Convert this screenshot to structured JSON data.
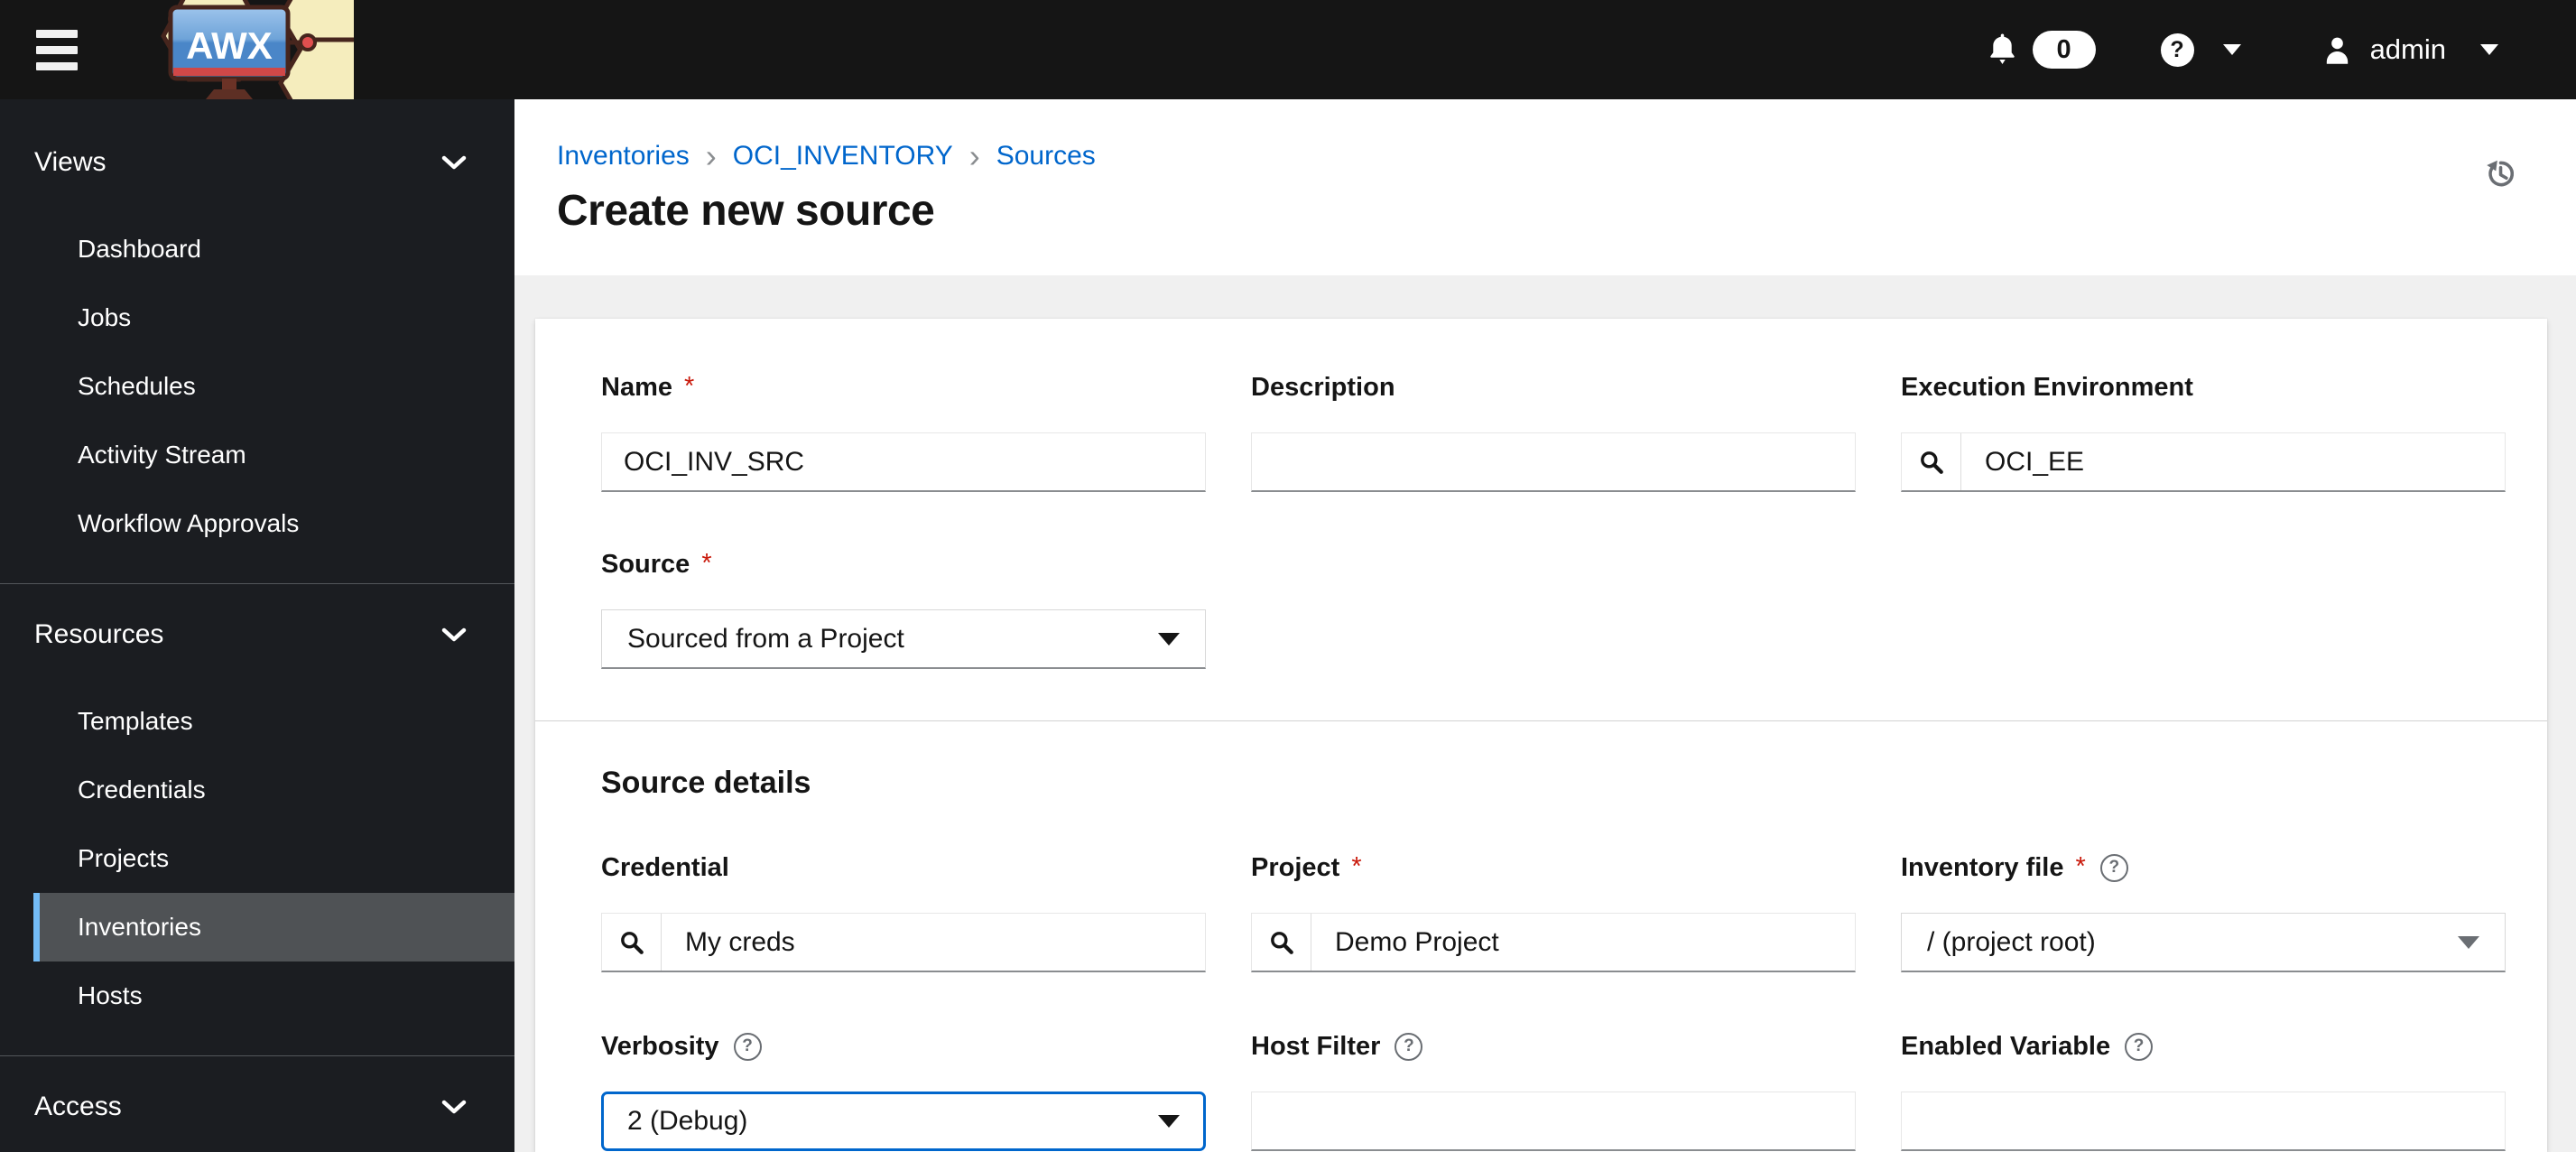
{
  "masthead": {
    "logo_text": "AWX",
    "notification_count": "0",
    "help_glyph": "?",
    "username": "admin"
  },
  "sidebar": {
    "groups": [
      {
        "label": "Views",
        "items": [
          {
            "label": "Dashboard"
          },
          {
            "label": "Jobs"
          },
          {
            "label": "Schedules"
          },
          {
            "label": "Activity Stream"
          },
          {
            "label": "Workflow Approvals"
          }
        ]
      },
      {
        "label": "Resources",
        "items": [
          {
            "label": "Templates"
          },
          {
            "label": "Credentials"
          },
          {
            "label": "Projects"
          },
          {
            "label": "Inventories"
          },
          {
            "label": "Hosts"
          }
        ]
      },
      {
        "label": "Access",
        "items": []
      }
    ]
  },
  "breadcrumb": {
    "separator": "›",
    "items": [
      {
        "label": "Inventories"
      },
      {
        "label": "OCI_INVENTORY"
      },
      {
        "label": "Sources"
      }
    ]
  },
  "page": {
    "title": "Create new source"
  },
  "form": {
    "required_marker": "*",
    "help_glyph": "?",
    "section_title": "Source details",
    "fields": {
      "name": {
        "label": "Name",
        "value": "OCI_INV_SRC"
      },
      "description": {
        "label": "Description",
        "value": ""
      },
      "execution_environment": {
        "label": "Execution Environment",
        "value": "OCI_EE"
      },
      "source": {
        "label": "Source",
        "value": "Sourced from a Project"
      },
      "credential": {
        "label": "Credential",
        "value": "My creds"
      },
      "project": {
        "label": "Project",
        "value": "Demo Project"
      },
      "inventory_file": {
        "label": "Inventory file",
        "value": "/ (project root)"
      },
      "verbosity": {
        "label": "Verbosity",
        "value": "2 (Debug)"
      },
      "host_filter": {
        "label": "Host Filter",
        "value": ""
      },
      "enabled_variable": {
        "label": "Enabled Variable",
        "value": ""
      }
    }
  },
  "colors": {
    "masthead_bg": "#151515",
    "sidebar_bg": "#1b1d21",
    "sidebar_selected_bg": "#4f5255",
    "sidebar_selected_accent": "#73bcf7",
    "link_blue": "#0066cc",
    "focus_blue": "#0066cc",
    "required_red": "#c9190b",
    "page_bg": "#f0f0f0"
  }
}
